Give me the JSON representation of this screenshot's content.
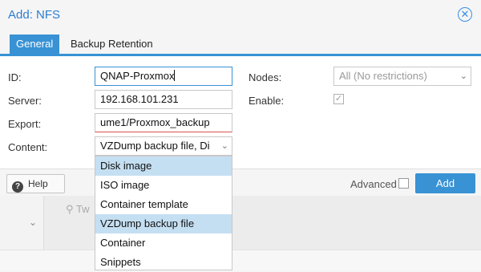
{
  "dialog": {
    "title": "Add: NFS",
    "close_icon": "close-icon"
  },
  "tabs": [
    {
      "label": "General",
      "active": true
    },
    {
      "label": "Backup Retention",
      "active": false
    }
  ],
  "form": {
    "id_label": "ID:",
    "id_value": "QNAP-Proxmox",
    "server_label": "Server:",
    "server_value": "192.168.101.231",
    "export_label": "Export:",
    "export_value": "ume1/Proxmox_backup",
    "content_label": "Content:",
    "content_value": "VZDump backup file, Di",
    "nodes_label": "Nodes:",
    "nodes_value": "All (No restrictions)",
    "enable_label": "Enable:",
    "enable_checked": true
  },
  "content_menu": {
    "items": [
      {
        "label": "Disk image",
        "selected": true
      },
      {
        "label": "ISO image",
        "selected": false
      },
      {
        "label": "Container template",
        "selected": false
      },
      {
        "label": "VZDump backup file",
        "selected": true
      },
      {
        "label": "Container",
        "selected": false
      },
      {
        "label": "Snippets",
        "selected": false
      }
    ]
  },
  "footer": {
    "help_label": "Help",
    "advanced_label": "Advanced",
    "add_label": "Add"
  },
  "background": {
    "tree_text": "Tw"
  },
  "colors": {
    "accent": "#3892d4",
    "title": "#2b7dd1",
    "selected_item": "#c5dff2",
    "invalid": "#d9534f"
  }
}
